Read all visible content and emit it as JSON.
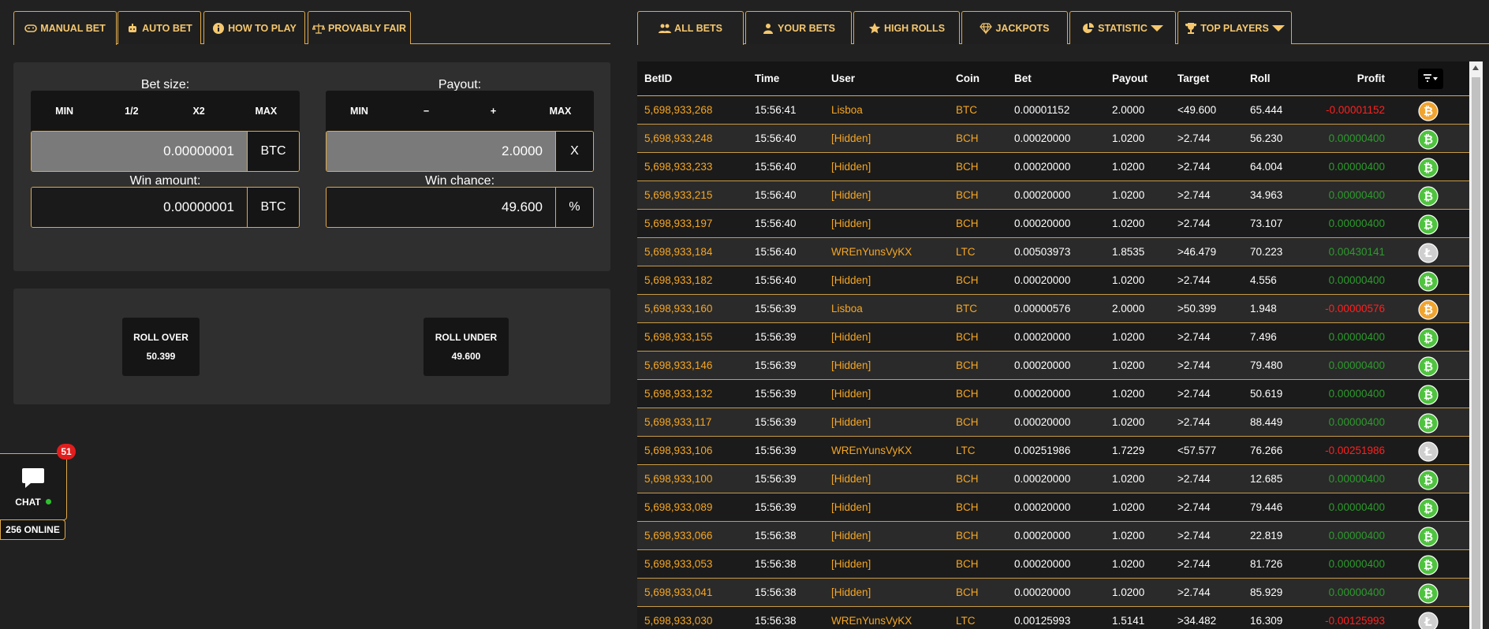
{
  "left_tabs": [
    {
      "label": "MANUAL BET",
      "icon": "gamepad-icon"
    },
    {
      "label": "AUTO BET",
      "icon": "robot-icon"
    },
    {
      "label": "HOW TO PLAY",
      "icon": "info-icon"
    },
    {
      "label": "PROVABLY FAIR",
      "icon": "scale-icon"
    }
  ],
  "bet_size": {
    "label": "Bet size:",
    "buttons": [
      "MIN",
      "1/2",
      "X2",
      "MAX"
    ],
    "value": "0.00000001",
    "unit": "BTC"
  },
  "payout": {
    "label": "Payout:",
    "buttons": [
      "MIN",
      "−",
      "+",
      "MAX"
    ],
    "value": "2.0000",
    "unit": "X"
  },
  "win_amount": {
    "label": "Win amount:",
    "value": "0.00000001",
    "unit": "BTC"
  },
  "win_chance": {
    "label": "Win chance:",
    "value": "49.600",
    "unit": "%"
  },
  "roll_over": {
    "label": "ROLL OVER",
    "value": "50.399"
  },
  "roll_under": {
    "label": "ROLL UNDER",
    "value": "49.600"
  },
  "chat": {
    "label": "CHAT",
    "badge": "51",
    "online": "256 ONLINE"
  },
  "right_tabs": [
    {
      "label": "ALL BETS",
      "icon": "users-icon"
    },
    {
      "label": "YOUR BETS",
      "icon": "user-icon"
    },
    {
      "label": "HIGH ROLLS",
      "icon": "star-icon"
    },
    {
      "label": "JACKPOTS",
      "icon": "diamond-icon"
    },
    {
      "label": "STATISTIC",
      "icon": "pie-chart-icon"
    },
    {
      "label": "TOP PLAYERS",
      "icon": "trophy-icon"
    }
  ],
  "table": {
    "headers": [
      "BetID",
      "Time",
      "User",
      "Coin",
      "Bet",
      "Payout",
      "Target",
      "Roll",
      "Profit"
    ],
    "rows": [
      [
        "5,698,933,268",
        "15:56:41",
        "Lisboa",
        "BTC",
        "0.00001152",
        "2.0000",
        "<49.600",
        "65.444",
        "-0.00001152"
      ],
      [
        "5,698,933,248",
        "15:56:40",
        "[Hidden]",
        "BCH",
        "0.00020000",
        "1.0200",
        ">2.744",
        "56.230",
        "0.00000400"
      ],
      [
        "5,698,933,233",
        "15:56:40",
        "[Hidden]",
        "BCH",
        "0.00020000",
        "1.0200",
        ">2.744",
        "64.004",
        "0.00000400"
      ],
      [
        "5,698,933,215",
        "15:56:40",
        "[Hidden]",
        "BCH",
        "0.00020000",
        "1.0200",
        ">2.744",
        "34.963",
        "0.00000400"
      ],
      [
        "5,698,933,197",
        "15:56:40",
        "[Hidden]",
        "BCH",
        "0.00020000",
        "1.0200",
        ">2.744",
        "73.107",
        "0.00000400"
      ],
      [
        "5,698,933,184",
        "15:56:40",
        "WREnYunsVyKX",
        "LTC",
        "0.00503973",
        "1.8535",
        ">46.479",
        "70.223",
        "0.00430141"
      ],
      [
        "5,698,933,182",
        "15:56:40",
        "[Hidden]",
        "BCH",
        "0.00020000",
        "1.0200",
        ">2.744",
        "4.556",
        "0.00000400"
      ],
      [
        "5,698,933,160",
        "15:56:39",
        "Lisboa",
        "BTC",
        "0.00000576",
        "2.0000",
        ">50.399",
        "1.948",
        "-0.00000576"
      ],
      [
        "5,698,933,155",
        "15:56:39",
        "[Hidden]",
        "BCH",
        "0.00020000",
        "1.0200",
        ">2.744",
        "7.496",
        "0.00000400"
      ],
      [
        "5,698,933,146",
        "15:56:39",
        "[Hidden]",
        "BCH",
        "0.00020000",
        "1.0200",
        ">2.744",
        "79.480",
        "0.00000400"
      ],
      [
        "5,698,933,132",
        "15:56:39",
        "[Hidden]",
        "BCH",
        "0.00020000",
        "1.0200",
        ">2.744",
        "50.619",
        "0.00000400"
      ],
      [
        "5,698,933,117",
        "15:56:39",
        "[Hidden]",
        "BCH",
        "0.00020000",
        "1.0200",
        ">2.744",
        "88.449",
        "0.00000400"
      ],
      [
        "5,698,933,106",
        "15:56:39",
        "WREnYunsVyKX",
        "LTC",
        "0.00251986",
        "1.7229",
        "<57.577",
        "76.266",
        "-0.00251986"
      ],
      [
        "5,698,933,100",
        "15:56:39",
        "[Hidden]",
        "BCH",
        "0.00020000",
        "1.0200",
        ">2.744",
        "12.685",
        "0.00000400"
      ],
      [
        "5,698,933,089",
        "15:56:39",
        "[Hidden]",
        "BCH",
        "0.00020000",
        "1.0200",
        ">2.744",
        "79.446",
        "0.00000400"
      ],
      [
        "5,698,933,066",
        "15:56:38",
        "[Hidden]",
        "BCH",
        "0.00020000",
        "1.0200",
        ">2.744",
        "22.819",
        "0.00000400"
      ],
      [
        "5,698,933,053",
        "15:56:38",
        "[Hidden]",
        "BCH",
        "0.00020000",
        "1.0200",
        ">2.744",
        "81.726",
        "0.00000400"
      ],
      [
        "5,698,933,041",
        "15:56:38",
        "[Hidden]",
        "BCH",
        "0.00020000",
        "1.0200",
        ">2.744",
        "85.929",
        "0.00000400"
      ],
      [
        "5,698,933,030",
        "15:56:38",
        "WREnYunsVyKX",
        "LTC",
        "0.00125993",
        "1.5141",
        ">34.482",
        "16.309",
        "-0.00125993"
      ]
    ]
  },
  "colors": {
    "accent": "#e0a94a",
    "btc": "#f0a430",
    "bch": "#4fc33f",
    "ltc": "#cfcfcf",
    "profit_pos": "#2d9b2d",
    "profit_neg": "#ff2020"
  }
}
